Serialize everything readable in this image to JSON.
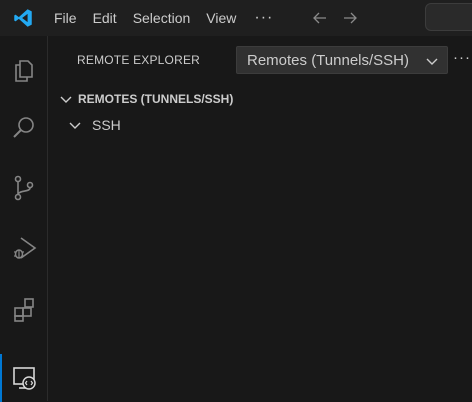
{
  "titlebar": {
    "app_icon": "vscode-logo",
    "menu": [
      "File",
      "Edit",
      "Selection",
      "View"
    ],
    "more_label": "···",
    "back_icon": "arrow-left-icon",
    "forward_icon": "arrow-right-icon"
  },
  "activitybar": {
    "items": [
      {
        "icon": "explorer-icon"
      },
      {
        "icon": "search-icon"
      },
      {
        "icon": "source-control-icon"
      },
      {
        "icon": "run-debug-icon"
      },
      {
        "icon": "extensions-icon"
      },
      {
        "icon": "remote-explorer-icon",
        "active": true
      }
    ]
  },
  "sidebar": {
    "title": "REMOTE EXPLORER",
    "select": {
      "value": "Remotes (Tunnels/SSH)"
    },
    "more_label": "···",
    "section": {
      "label": "REMOTES (TUNNELS/SSH)"
    },
    "tree": [
      {
        "label": "SSH"
      }
    ]
  },
  "colors": {
    "background": "#181818",
    "titlebar": "#1f1f1f",
    "accent": "#0078d4",
    "logo_blue": "#23a9f2",
    "text": "#cccccc"
  }
}
